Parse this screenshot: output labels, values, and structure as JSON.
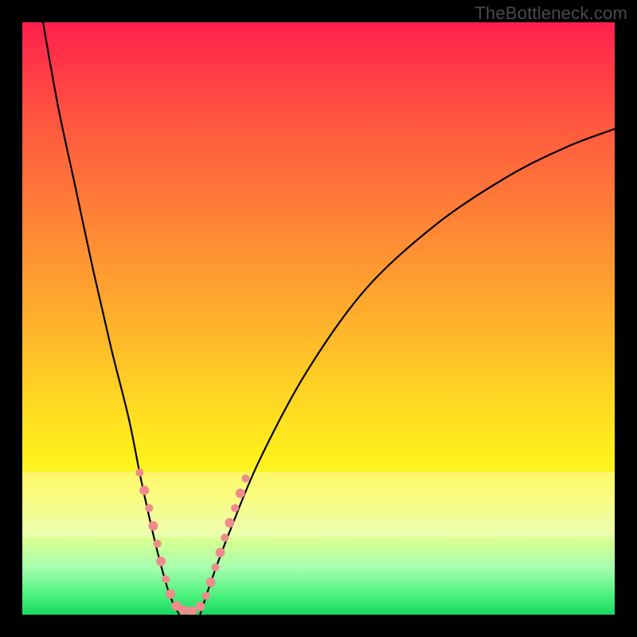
{
  "watermark": "TheBottleneck.com",
  "chart_data": {
    "type": "line",
    "title": "",
    "xlabel": "",
    "ylabel": "",
    "xlim": [
      0,
      100
    ],
    "ylim": [
      0,
      100
    ],
    "gradient_stops": [
      {
        "pos": 0,
        "color": "#ff1f4d"
      },
      {
        "pos": 8,
        "color": "#ff3a46"
      },
      {
        "pos": 18,
        "color": "#ff5a3f"
      },
      {
        "pos": 30,
        "color": "#ff7a38"
      },
      {
        "pos": 42,
        "color": "#ff9a31"
      },
      {
        "pos": 54,
        "color": "#ffbb2a"
      },
      {
        "pos": 64,
        "color": "#ffd822"
      },
      {
        "pos": 74,
        "color": "#fff11b"
      },
      {
        "pos": 80,
        "color": "#f7fb48"
      },
      {
        "pos": 86,
        "color": "#e6ff88"
      },
      {
        "pos": 92,
        "color": "#a7ffae"
      },
      {
        "pos": 97,
        "color": "#46f07a"
      },
      {
        "pos": 100,
        "color": "#18d85e"
      }
    ],
    "pale_band": {
      "top_pct": 76,
      "height_pct": 11,
      "alpha": 0.3
    },
    "series": [
      {
        "name": "left_branch",
        "x": [
          3.5,
          6,
          9,
          12,
          15,
          18,
          20,
          22,
          23.5,
          25,
          26.5
        ],
        "y": [
          100,
          86,
          72,
          58,
          45,
          33,
          23,
          14,
          8,
          3,
          0
        ]
      },
      {
        "name": "right_branch",
        "x": [
          30,
          32,
          35,
          40,
          48,
          58,
          70,
          82,
          92,
          100
        ],
        "y": [
          0,
          6,
          14,
          26,
          41,
          55,
          66,
          74,
          79,
          82
        ]
      }
    ],
    "beads": {
      "color": "#ef8b8b",
      "points": [
        {
          "x": 19.8,
          "y": 24,
          "r": 5
        },
        {
          "x": 20.6,
          "y": 21,
          "r": 6
        },
        {
          "x": 21.4,
          "y": 18,
          "r": 5
        },
        {
          "x": 22.1,
          "y": 15,
          "r": 6
        },
        {
          "x": 22.8,
          "y": 12,
          "r": 5
        },
        {
          "x": 23.4,
          "y": 9,
          "r": 6
        },
        {
          "x": 24.2,
          "y": 6,
          "r": 5
        },
        {
          "x": 25.0,
          "y": 3.5,
          "r": 6
        },
        {
          "x": 26.0,
          "y": 1.5,
          "r": 6
        },
        {
          "x": 27.2,
          "y": 0.8,
          "r": 6
        },
        {
          "x": 28.6,
          "y": 0.6,
          "r": 6
        },
        {
          "x": 30.0,
          "y": 1.4,
          "r": 6
        },
        {
          "x": 31.0,
          "y": 3.2,
          "r": 5
        },
        {
          "x": 31.8,
          "y": 5.5,
          "r": 6
        },
        {
          "x": 32.6,
          "y": 8,
          "r": 5
        },
        {
          "x": 33.4,
          "y": 10.5,
          "r": 6
        },
        {
          "x": 34.2,
          "y": 13,
          "r": 5
        },
        {
          "x": 35.0,
          "y": 15.5,
          "r": 6
        },
        {
          "x": 35.9,
          "y": 18,
          "r": 5
        },
        {
          "x": 36.8,
          "y": 20.5,
          "r": 6
        },
        {
          "x": 37.7,
          "y": 23,
          "r": 5
        }
      ]
    }
  }
}
